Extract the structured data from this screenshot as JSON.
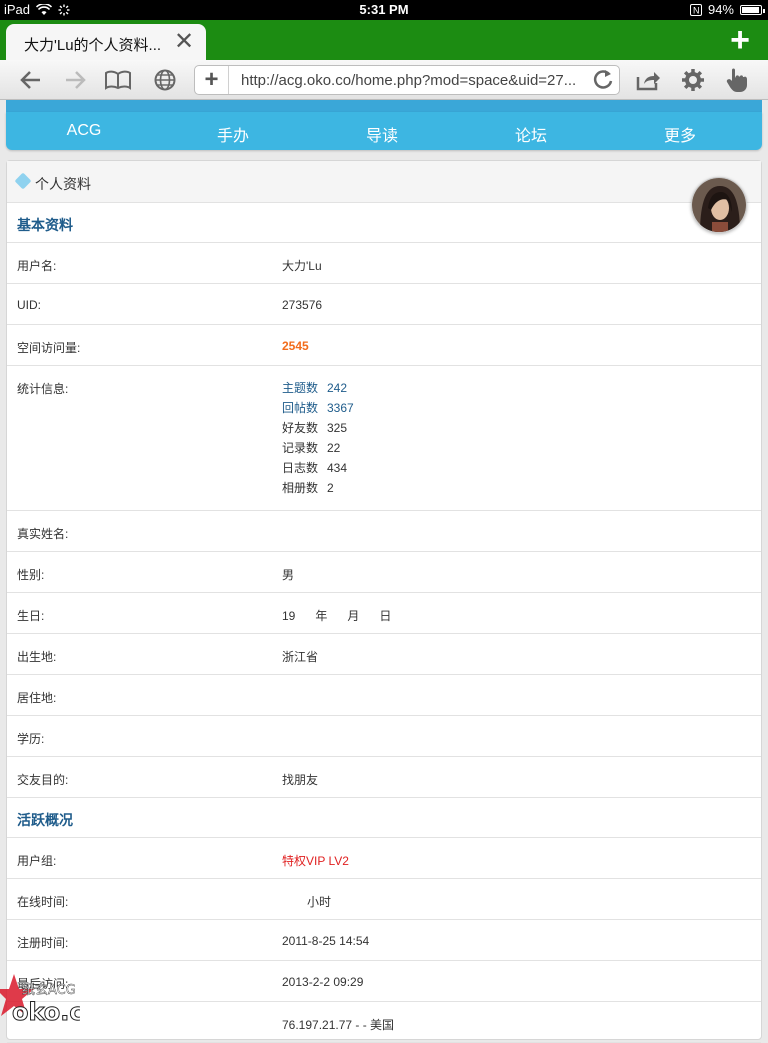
{
  "status": {
    "device": "iPad",
    "time": "5:31 PM",
    "battery": "94%",
    "battery_level": 0.94
  },
  "tab": {
    "title": "大力'Lu的个人资料...",
    "close": "✕",
    "new_tab": "+"
  },
  "toolbar": {
    "url": "http://acg.oko.co/home.php?mod=space&uid=27..."
  },
  "sitenav": [
    "ACG",
    "手办",
    "导读",
    "论坛",
    "更多"
  ],
  "panel": {
    "title": "个人资料",
    "section_basic": "基本资料",
    "section_active": "活跃概况"
  },
  "rows": {
    "username": {
      "k": "用户名:",
      "v": "大力'Lu"
    },
    "uid": {
      "k": "UID:",
      "v": "273576"
    },
    "visits": {
      "k": "空间访问量:",
      "v": "2545"
    },
    "stats_label": "统计信息:",
    "realname": {
      "k": "真实姓名:",
      "v": ""
    },
    "gender": {
      "k": "性别:",
      "v": "男"
    },
    "birthday": {
      "k": "生日:",
      "v": "19      年      月      日"
    },
    "birthplace": {
      "k": "出生地:",
      "v": "浙江省"
    },
    "residence": {
      "k": "居住地:",
      "v": ""
    },
    "education": {
      "k": "学历:",
      "v": ""
    },
    "purpose": {
      "k": "交友目的:",
      "v": "找朋友"
    },
    "usergroup": {
      "k": "用户组:",
      "v": "特权VIP LV2"
    },
    "online": {
      "k": "在线时间:",
      "v": "小时"
    },
    "regtime": {
      "k": "注册时间:",
      "v": "2011-8-25 14:54"
    },
    "lastvisit": {
      "k": "最后访问:",
      "v": "2013-2-2 09:29"
    },
    "ip": {
      "k": "",
      "v": "76.197.21.77 - - 美国"
    }
  },
  "stats": [
    {
      "label": "主题数",
      "value": "242"
    },
    {
      "label": "回帖数",
      "value": "3367"
    },
    {
      "label": "好友数",
      "value": "325"
    },
    {
      "label": "记录数",
      "value": "22"
    },
    {
      "label": "日志数",
      "value": "434"
    },
    {
      "label": "相册数",
      "value": "2"
    }
  ],
  "watermark": {
    "text1": "纸玄ACG",
    "text2": "oko.co"
  },
  "colors": {
    "tabbar": "#1c8c12",
    "nav": "#3db6e2",
    "link": "#1f5c8b",
    "visits": "#f26c1b",
    "group": "#e02020"
  }
}
